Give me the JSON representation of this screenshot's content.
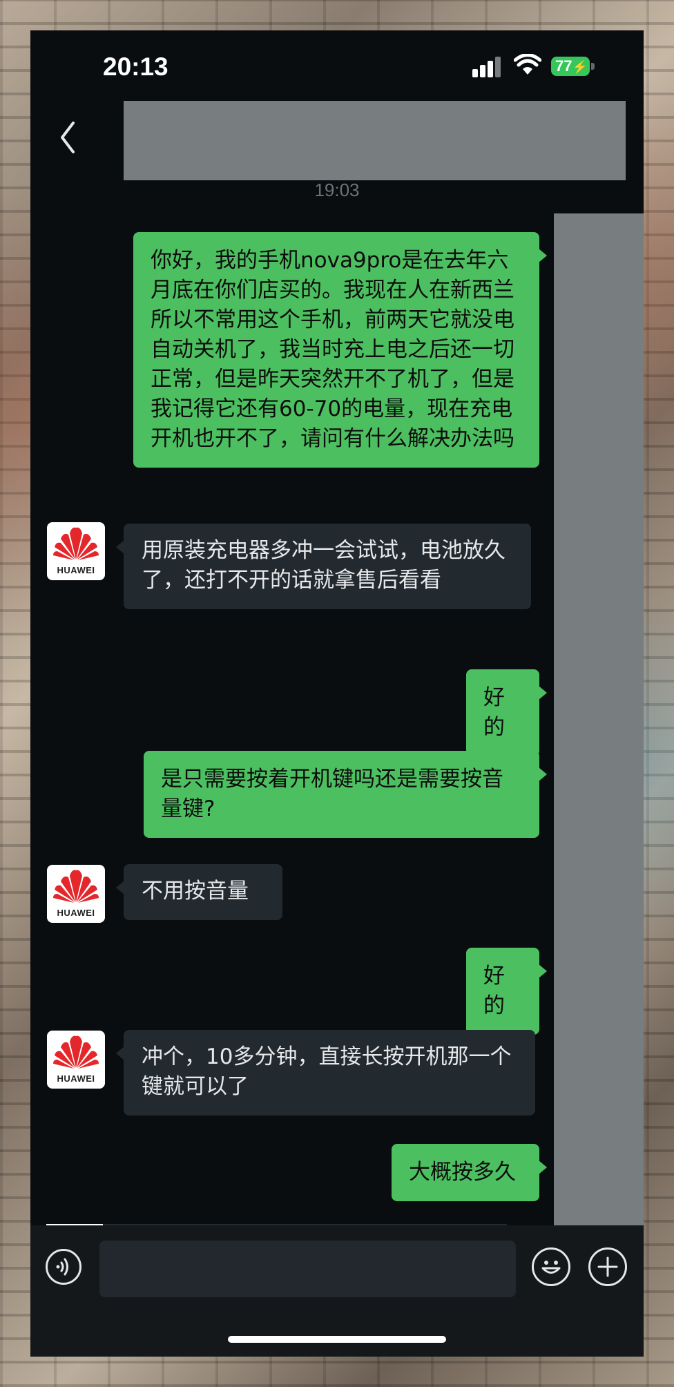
{
  "status_bar": {
    "time": "20:13",
    "battery": "77"
  },
  "chat": {
    "timestamp": "19:03",
    "contact_brand": "HUAWEI",
    "messages": [
      {
        "side": "out",
        "text": "你好，我的手机nova9pro是在去年六月底在你们店买的。我现在人在新西兰所以不常用这个手机，前两天它就没电自动关机了，我当时充上电之后还一切正常，但是昨天突然开不了机了，但是我记得它还有60-70的电量，现在充电开机也开不了，请问有什么解决办法吗"
      },
      {
        "side": "in",
        "text": "用原装充电器多冲一会试试，电池放久了，还打不开的话就拿售后看看"
      },
      {
        "side": "out",
        "text": "好的"
      },
      {
        "side": "out",
        "text": "是只需要按着开机键吗还是需要按音量键?"
      },
      {
        "side": "in",
        "text": "不用按音量"
      },
      {
        "side": "out",
        "text": "好的"
      },
      {
        "side": "in",
        "text": "冲个，10多分钟，直接长按开机那一个键就可以了"
      },
      {
        "side": "out",
        "text": "大概按多久"
      }
    ]
  },
  "input": {
    "value": "",
    "placeholder": ""
  },
  "icons": {
    "back": "chevron-left-icon",
    "voice": "voice-icon",
    "emoji": "emoji-icon",
    "plus": "plus-icon"
  },
  "colors": {
    "outgoing_bubble": "#4cc060",
    "incoming_bubble": "#222a30",
    "background": "#0a0d10",
    "redaction": "#787d80",
    "battery": "#35c759"
  }
}
